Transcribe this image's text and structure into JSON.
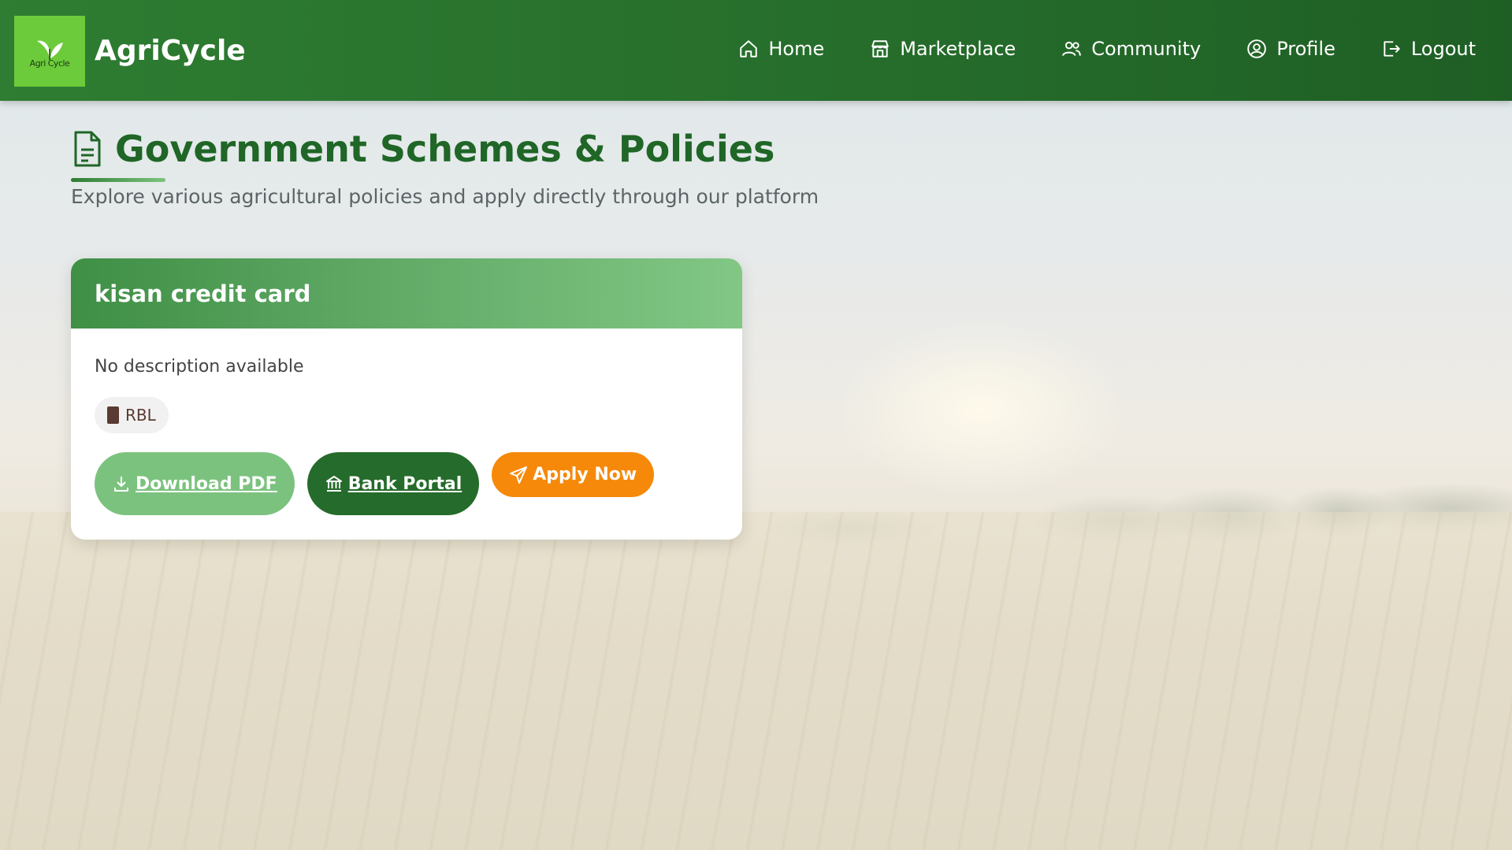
{
  "app": {
    "brand": "AgriCycle",
    "logo_text": "Agri Cycle"
  },
  "nav": {
    "items": [
      {
        "label": "Home",
        "icon": "home-icon"
      },
      {
        "label": "Marketplace",
        "icon": "store-icon"
      },
      {
        "label": "Community",
        "icon": "users-icon"
      },
      {
        "label": "Profile",
        "icon": "user-circle-icon"
      },
      {
        "label": "Logout",
        "icon": "logout-icon"
      }
    ]
  },
  "page": {
    "title": "Government Schemes & Policies",
    "title_icon": "document-icon",
    "subtitle": "Explore various agricultural policies and apply directly through our platform"
  },
  "scheme": {
    "title": "kisan credit card",
    "description": "No description available",
    "bank": "RBL",
    "bank_icon": "book-icon",
    "download_label": "Download PDF",
    "bank_portal_label": "Bank Portal",
    "apply_label": "Apply Now"
  },
  "colors": {
    "header": "#2e7d32",
    "title": "#1f6627",
    "apply": "#f6890a",
    "bank_portal": "#256b2b",
    "download": "#7cc27f"
  }
}
